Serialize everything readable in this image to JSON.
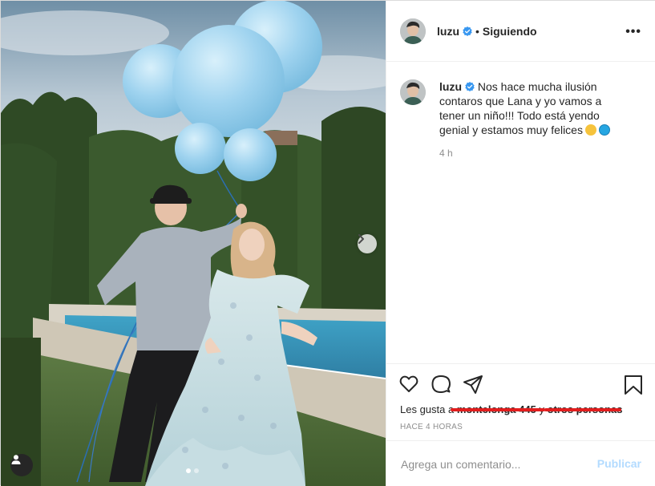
{
  "post": {
    "username": "luzu",
    "follow_status": "Siguiendo",
    "separator": "•",
    "more_label": "•••",
    "caption_text": "Nos hace mucha ilusión contaros que Lana y yo vamos a tener un niño!!! Todo está yendo genial y estamos muy felices",
    "caption_time": "4 h",
    "likes_prefix": "Les gusta a",
    "likes_name_1": "montelonga 445",
    "likes_join": "y",
    "likes_name_2": "otros personas",
    "posted_ago": "HACE 4 HORAS"
  },
  "comment": {
    "placeholder": "Agrega un comentario...",
    "publish_label": "Publicar"
  },
  "carousel": {
    "slide_count": 2,
    "active_index": 0
  },
  "icons": {
    "verified": "verified-badge-icon",
    "like": "heart-icon",
    "comment": "comment-bubble-icon",
    "share": "paper-plane-icon",
    "save": "bookmark-icon",
    "next": "chevron-right-icon",
    "tags": "user-tag-icon"
  },
  "colors": {
    "accent": "#0095f6",
    "publish_disabled": "#b3dbff",
    "balloon": "#9fd3ef",
    "verified": "#3897f0",
    "redaction": "#e21e1e"
  }
}
